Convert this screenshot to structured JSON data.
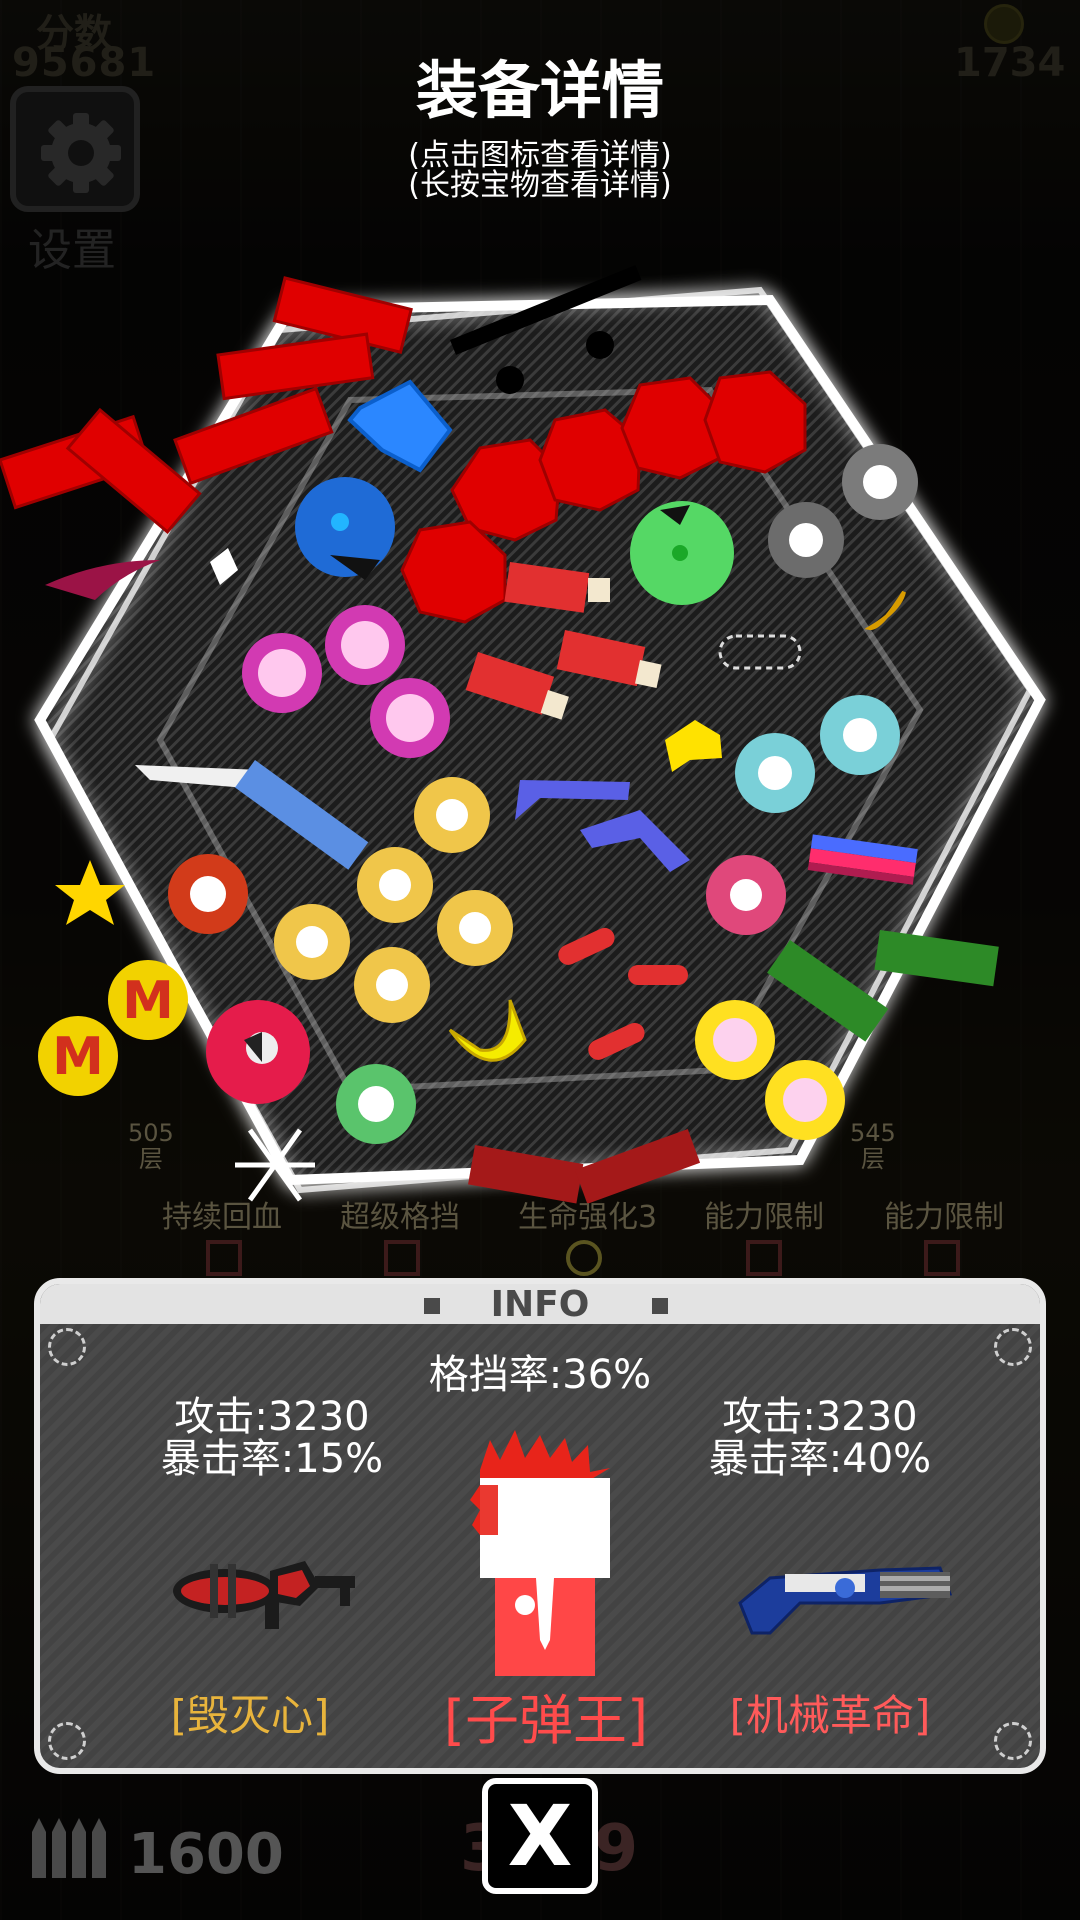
{
  "hud": {
    "score_label": "分数",
    "score_value": "95681",
    "coins": "1734",
    "settings_label": "设置",
    "ammo_count": "1600",
    "bottom_number": "3759"
  },
  "header": {
    "title": "装备详情",
    "hint_tap": "(点击图标查看详情)",
    "hint_long_press": "(长按宝物查看详情)"
  },
  "background_floors": [
    {
      "floor": "505",
      "unit": "层"
    },
    {
      "floor": "545",
      "unit": "层"
    }
  ],
  "background_skills": [
    "持续回血",
    "超级格挡",
    "生命强化3",
    "能力限制",
    "能力限制"
  ],
  "info_panel": {
    "title": "INFO",
    "block_rate": "格挡率:36%",
    "left_weapon": {
      "attack": "攻击:3230",
      "crit": "暴击率:15%",
      "name": "[毁灭心]",
      "icon": "red-blaster-icon"
    },
    "character": {
      "name": "[子弹王]",
      "icon": "bullet-king-character-icon"
    },
    "right_weapon": {
      "attack": "攻击:3230",
      "crit": "暴击率:40%",
      "name": "[机械革命]",
      "icon": "blue-minigun-icon"
    }
  },
  "close_button": {
    "label": "X"
  },
  "colors": {
    "left_name": "#e8b43c",
    "char_name": "#ff4b4b",
    "right_name": "#ff5a5a",
    "panel_border": "#e9e9e9"
  }
}
